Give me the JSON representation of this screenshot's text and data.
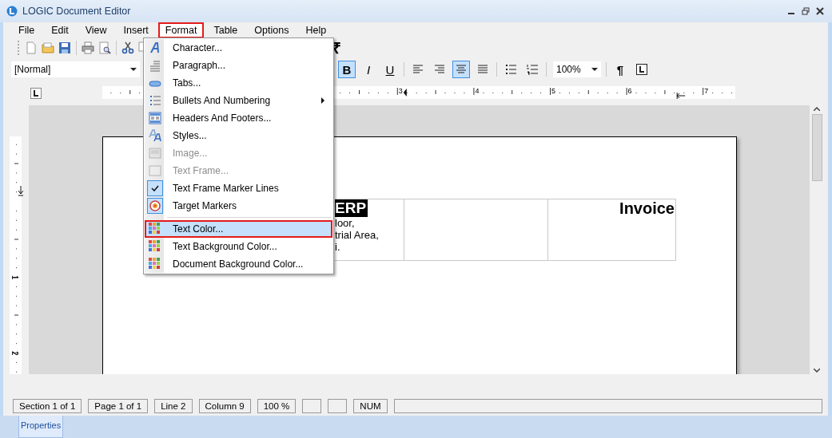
{
  "window": {
    "title": "LOGIC Document Editor"
  },
  "menu_bar": [
    {
      "label": "File",
      "selected": false
    },
    {
      "label": "Edit",
      "selected": false
    },
    {
      "label": "View",
      "selected": false
    },
    {
      "label": "Insert",
      "selected": false
    },
    {
      "label": "Format",
      "selected": true
    },
    {
      "label": "Table",
      "selected": false
    },
    {
      "label": "Options",
      "selected": false
    },
    {
      "label": "Help",
      "selected": false
    }
  ],
  "format_menu": {
    "items": [
      {
        "kind": "item",
        "label": "Character...",
        "disabled": false,
        "checked": false,
        "submenu": false,
        "selected": false
      },
      {
        "kind": "item",
        "label": "Paragraph...",
        "disabled": false,
        "checked": false,
        "submenu": false,
        "selected": false
      },
      {
        "kind": "item",
        "label": "Tabs...",
        "disabled": false,
        "checked": false,
        "submenu": false,
        "selected": false
      },
      {
        "kind": "item",
        "label": "Bullets And Numbering",
        "disabled": false,
        "checked": false,
        "submenu": true,
        "selected": false
      },
      {
        "kind": "item",
        "label": "Headers And Footers...",
        "disabled": false,
        "checked": false,
        "submenu": false,
        "selected": false
      },
      {
        "kind": "item",
        "label": "Styles...",
        "disabled": false,
        "checked": false,
        "submenu": false,
        "selected": false
      },
      {
        "kind": "item",
        "label": "Image...",
        "disabled": true,
        "checked": false,
        "submenu": false,
        "selected": false
      },
      {
        "kind": "item",
        "label": "Text Frame...",
        "disabled": true,
        "checked": false,
        "submenu": false,
        "selected": false
      },
      {
        "kind": "item",
        "label": "Text Frame Marker Lines",
        "disabled": false,
        "checked": true,
        "submenu": false,
        "selected": false
      },
      {
        "kind": "item",
        "label": "Target Markers",
        "disabled": false,
        "checked": true,
        "submenu": false,
        "selected": false
      },
      {
        "kind": "separator"
      },
      {
        "kind": "item",
        "label": "Text Color...",
        "disabled": false,
        "checked": false,
        "submenu": false,
        "selected": true
      },
      {
        "kind": "item",
        "label": "Text Background Color...",
        "disabled": false,
        "checked": false,
        "submenu": false,
        "selected": false
      },
      {
        "kind": "item",
        "label": "Document Background Color...",
        "disabled": false,
        "checked": false,
        "submenu": false,
        "selected": false
      }
    ]
  },
  "toolbar": {
    "currency_symbol": "₹",
    "style_combo": {
      "value": "[Normal]"
    },
    "format_buttons": [
      {
        "label": "B",
        "selected": true
      },
      {
        "label": "I",
        "selected": false
      },
      {
        "label": "U",
        "selected": false
      }
    ],
    "align_buttons": [
      {
        "selected": false
      },
      {
        "selected": false
      },
      {
        "selected": true
      },
      {
        "selected": false
      }
    ],
    "zoom_combo": {
      "value": "100%"
    },
    "pilcrow": "¶"
  },
  "ruler": {
    "labels": [
      "3",
      "4",
      "5",
      "6",
      "7"
    ]
  },
  "vertical_ruler": {
    "labels": [
      "1",
      "2"
    ]
  },
  "document": {
    "table": {
      "cells": [
        {
          "kind": "company",
          "heading": "ERP",
          "lines": [
            "loor,",
            "trial Area,",
            "i."
          ]
        },
        {
          "kind": "blank"
        },
        {
          "kind": "title",
          "heading": "Invoice"
        }
      ]
    }
  },
  "status_bar": {
    "panes": [
      {
        "kind": "text",
        "text": "Section 1 of 1"
      },
      {
        "kind": "text",
        "text": "Page 1 of 1"
      },
      {
        "kind": "text",
        "text": "Line 2"
      },
      {
        "kind": "text",
        "text": "Column 9"
      },
      {
        "kind": "text",
        "text": "100 %"
      },
      {
        "kind": "blank"
      },
      {
        "kind": "blank"
      },
      {
        "kind": "text",
        "text": "NUM"
      },
      {
        "kind": "blank"
      }
    ]
  },
  "bottom_tabs": [
    {
      "label": "Properties",
      "selected": true
    }
  ]
}
